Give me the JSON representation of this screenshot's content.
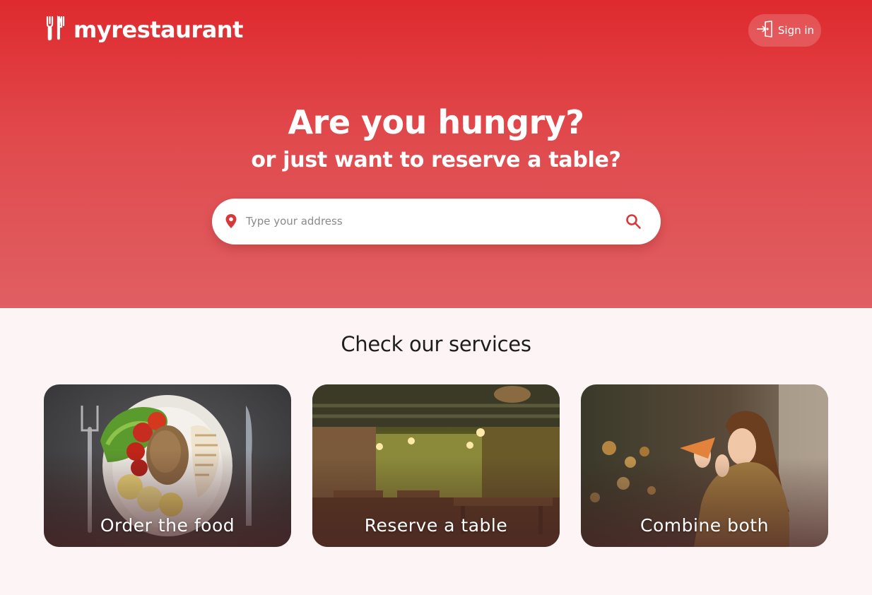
{
  "brand": {
    "name": "myrestaurant",
    "icon": "fork-knife-icon"
  },
  "header": {
    "signin_label": "Sign in",
    "signin_icon": "sign-in-icon"
  },
  "hero": {
    "title": "Are you hungry?",
    "subtitle": "or just want to reserve a table?",
    "search": {
      "placeholder": "Type your address",
      "value": ""
    }
  },
  "services": {
    "title": "Check our services",
    "cards": [
      {
        "label": "Order the food"
      },
      {
        "label": "Reserve a table"
      },
      {
        "label": "Combine both"
      }
    ]
  },
  "colors": {
    "brand_red": "#df2a2e",
    "page_bg": "#fdf5f5"
  }
}
